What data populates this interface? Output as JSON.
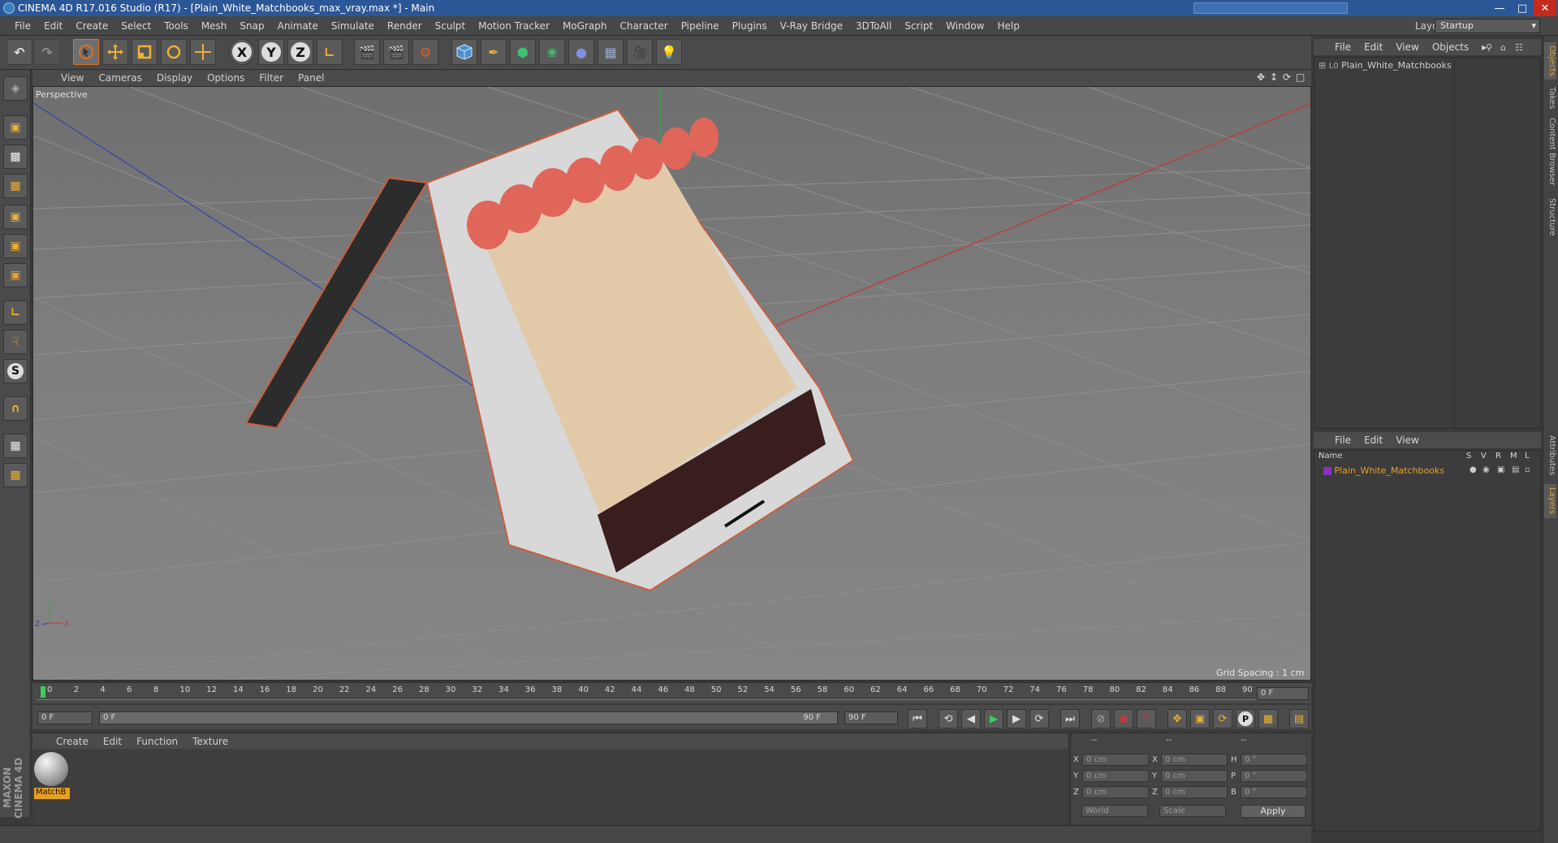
{
  "window": {
    "title": "CINEMA 4D R17.016 Studio (R17) - [Plain_White_Matchbooks_max_vray.max *] - Main",
    "minimize": "—",
    "maximize": "□",
    "close": "✕"
  },
  "menu": [
    "File",
    "Edit",
    "Create",
    "Select",
    "Tools",
    "Mesh",
    "Snap",
    "Animate",
    "Simulate",
    "Render",
    "Sculpt",
    "Motion Tracker",
    "MoGraph",
    "Character",
    "Pipeline",
    "Plugins",
    "V-Ray Bridge",
    "3DToAll",
    "Script",
    "Window",
    "Help"
  ],
  "layout": {
    "label": "Layout:",
    "value": "Startup"
  },
  "toolbar": {
    "undo_icon": "↶",
    "axis_x": "X",
    "axis_y": "Y",
    "axis_z": "Z"
  },
  "viewport": {
    "menu": [
      "View",
      "Cameras",
      "Display",
      "Options",
      "Filter",
      "Panel"
    ],
    "camera_label": "Perspective",
    "grid_spacing": "Grid Spacing : 1 cm",
    "axis_labels": {
      "x": "X",
      "y": "Y",
      "z": "Z"
    }
  },
  "timeline": {
    "ticks": [
      "0",
      "2",
      "4",
      "6",
      "8",
      "10",
      "12",
      "14",
      "16",
      "18",
      "20",
      "22",
      "24",
      "26",
      "28",
      "30",
      "32",
      "34",
      "36",
      "38",
      "40",
      "42",
      "44",
      "46",
      "48",
      "50",
      "52",
      "54",
      "56",
      "58",
      "60",
      "62",
      "64",
      "66",
      "68",
      "70",
      "72",
      "74",
      "76",
      "78",
      "80",
      "82",
      "84",
      "86",
      "88",
      "90"
    ],
    "current_frame": "0 F"
  },
  "animation": {
    "start": "0 F",
    "range_start": "0 F",
    "range_end": "90 F",
    "end": "90 F"
  },
  "material_manager": {
    "menu": [
      "Create",
      "Edit",
      "Function",
      "Texture"
    ],
    "material_name": "MatchB"
  },
  "coordinates": {
    "col_headers": [
      "--",
      "--",
      "--"
    ],
    "rows": [
      {
        "a": "X",
        "av": "0 cm",
        "b": "X",
        "bv": "0 cm",
        "c": "H",
        "cv": "0 °"
      },
      {
        "a": "Y",
        "av": "0 cm",
        "b": "Y",
        "bv": "0 cm",
        "c": "P",
        "cv": "0 °"
      },
      {
        "a": "Z",
        "av": "0 cm",
        "b": "Z",
        "bv": "0 cm",
        "c": "B",
        "cv": "0 °"
      }
    ],
    "world": "World",
    "scale": "Scale",
    "apply": "Apply"
  },
  "objects_panel": {
    "menu": [
      "File",
      "Edit",
      "View",
      "Objects"
    ],
    "object_name": "Plain_White_Matchbooks"
  },
  "layers_panel": {
    "menu": [
      "File",
      "Edit",
      "View"
    ],
    "columns": {
      "name": "Name",
      "s": "S",
      "v": "V",
      "r": "R",
      "m": "M",
      "l": "L"
    },
    "layer_name": "Plain_White_Matchbooks"
  },
  "right_tabs": [
    "Objects",
    "Takes",
    "Content Browser",
    "Structure",
    "Attributes",
    "Layers"
  ],
  "branding": {
    "logo": "MAXON CINEMA 4D"
  },
  "colors": {
    "title_bar": "#2b5797",
    "accent": "#e07020",
    "layer": "#e8a020",
    "grid_x": "#cc3333",
    "grid_z": "#3344aa"
  }
}
